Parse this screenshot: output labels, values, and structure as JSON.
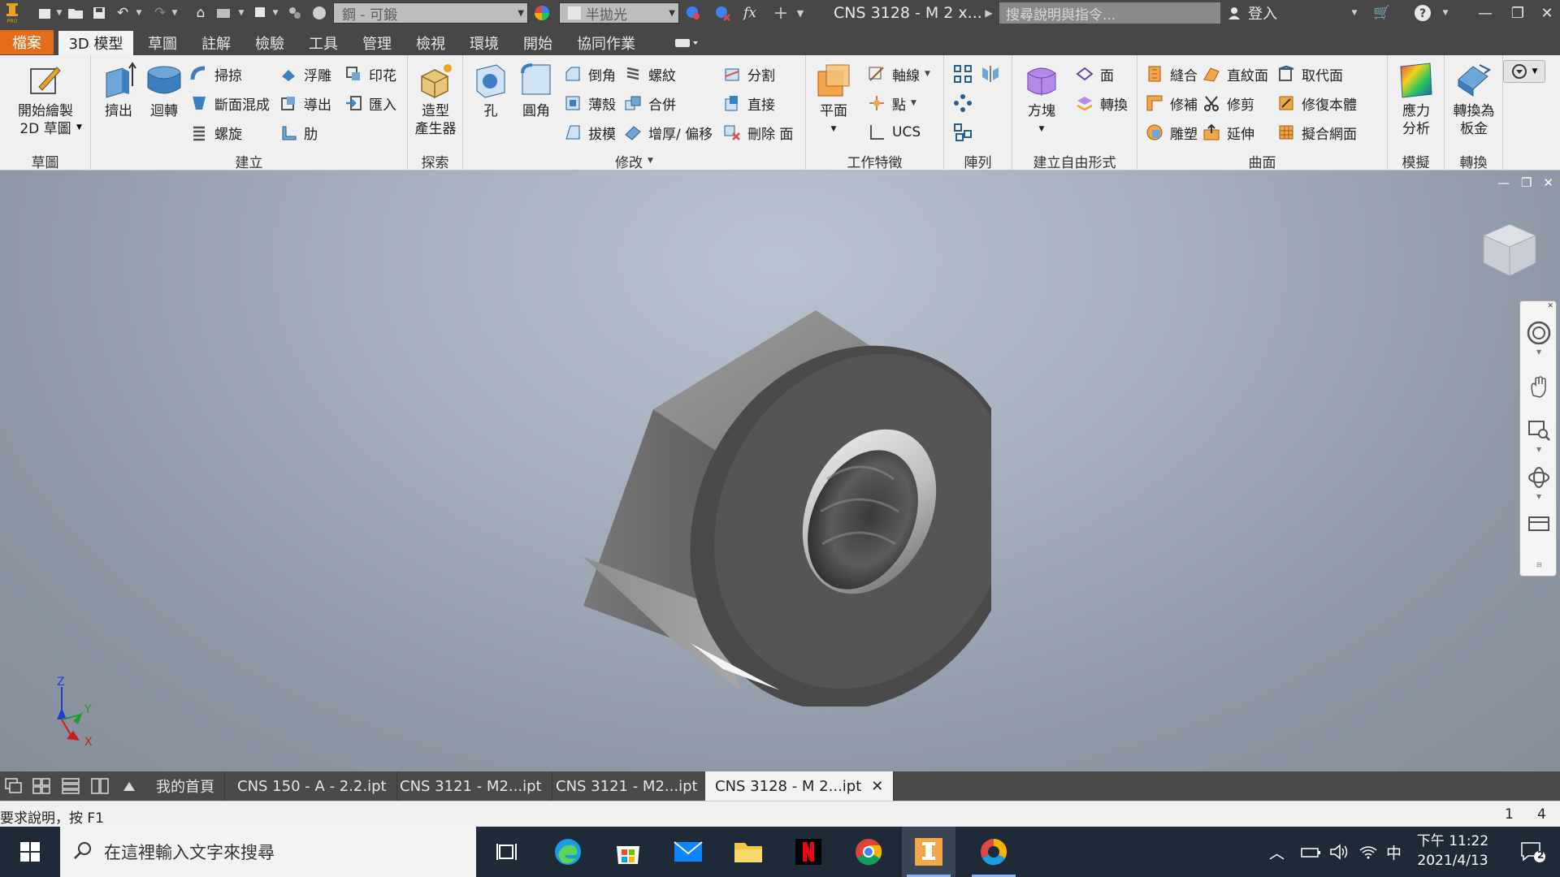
{
  "titlebar": {
    "material": "鋼 - 可鍛",
    "appearance": "半拋光",
    "fx_symbol": "fx",
    "doc_title": "CNS 3128 - M 2 x...",
    "search_placeholder": "搜尋說明與指令...",
    "signin": "登入"
  },
  "tabs": [
    "檔案",
    "3D 模型",
    "草圖",
    "註解",
    "檢驗",
    "工具",
    "管理",
    "檢視",
    "環境",
    "開始",
    "協同作業"
  ],
  "ribbon": {
    "sketch": {
      "title": "草圖",
      "start_2d_line1": "開始繪製",
      "start_2d_line2": "2D 草圖"
    },
    "create": {
      "title": "建立",
      "extrude": "擠出",
      "revolve": "迴轉",
      "sweep": "掃掠",
      "loft": "斷面混成",
      "coil": "螺旋",
      "emboss": "浮雕",
      "decal": "導出",
      "rib": "肋",
      "stamp": "印花",
      "import": "匯入"
    },
    "explore": {
      "title": "探索",
      "shape_gen_line1": "造型",
      "shape_gen_line2": "產生器"
    },
    "modify": {
      "title": "修改",
      "hole": "孔",
      "fillet": "圓角",
      "chamfer": "倒角",
      "shell": "薄殼",
      "draft": "拔模",
      "thread": "螺紋",
      "combine": "合併",
      "thicken": "增厚/ 偏移",
      "split": "分割",
      "direct": "直接",
      "delete_face": "刪除 面"
    },
    "work": {
      "title": "工作特徵",
      "plane": "平面",
      "axis": "軸線",
      "point": "點",
      "ucs": "UCS"
    },
    "pattern": {
      "title": "陣列"
    },
    "freeform": {
      "title": "建立自由形式",
      "box": "方塊",
      "face": "面",
      "convert": "轉換"
    },
    "surface": {
      "title": "曲面",
      "stitch": "縫合",
      "patch": "修補",
      "sculpt": "雕塑",
      "ruled": "直紋面",
      "trim": "修剪",
      "extend": "延伸",
      "replace": "取代面",
      "repair": "修復本體",
      "fit_mesh": "擬合網面"
    },
    "simulation": {
      "title": "模擬",
      "stress_line1": "應力",
      "stress_line2": "分析"
    },
    "convert": {
      "title": "轉換",
      "sheet_line1": "轉換為",
      "sheet_line2": "板金"
    }
  },
  "viewport": {
    "triad": {
      "x": "X",
      "y": "Y",
      "z": "Z"
    }
  },
  "doctabs": [
    "我的首頁",
    "CNS 150 - A - 2.2.ipt",
    "CNS 3121 - M2...ipt",
    "CNS 3121 - M2...ipt",
    "CNS 3128 - M 2...ipt"
  ],
  "status": {
    "help": "要求說明，按 F1",
    "num1": "1",
    "num2": "4"
  },
  "taskbar": {
    "search_placeholder": "在這裡輸入文字來搜尋",
    "ime": "中",
    "time": "下午 11:22",
    "date": "2021/4/13",
    "notify_count": "2"
  },
  "colors": {
    "file_tab": "#e36d1a",
    "titlebar": "#474747",
    "ribbon": "#f0f0f0",
    "taskbar": "#1f2a38"
  }
}
